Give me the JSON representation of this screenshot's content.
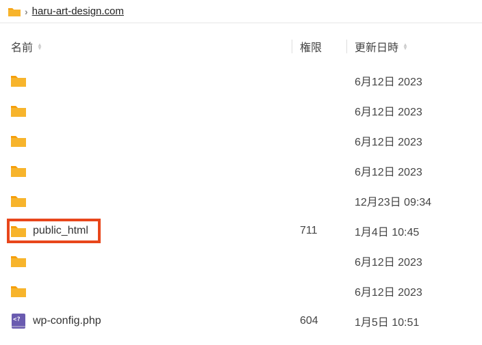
{
  "breadcrumb": {
    "label": "haru-art-design.com"
  },
  "columns": {
    "name": "名前",
    "perm": "権限",
    "date": "更新日時"
  },
  "rows": [
    {
      "type": "folder",
      "name": "",
      "perm": "",
      "date": "6月12日 2023",
      "highlight": false
    },
    {
      "type": "folder",
      "name": "",
      "perm": "",
      "date": "6月12日 2023",
      "highlight": false
    },
    {
      "type": "folder",
      "name": "",
      "perm": "",
      "date": "6月12日 2023",
      "highlight": false
    },
    {
      "type": "folder",
      "name": "",
      "perm": "",
      "date": "6月12日 2023",
      "highlight": false
    },
    {
      "type": "folder",
      "name": "",
      "perm": "",
      "date": "12月23日 09:34",
      "highlight": false
    },
    {
      "type": "folder",
      "name": "public_html",
      "perm": "711",
      "date": "1月4日 10:45",
      "highlight": true
    },
    {
      "type": "folder",
      "name": "",
      "perm": "",
      "date": "6月12日 2023",
      "highlight": false
    },
    {
      "type": "folder",
      "name": "",
      "perm": "",
      "date": "6月12日 2023",
      "highlight": false
    },
    {
      "type": "php",
      "name": "wp-config.php",
      "perm": "604",
      "date": "1月5日 10:51",
      "highlight": false
    }
  ]
}
